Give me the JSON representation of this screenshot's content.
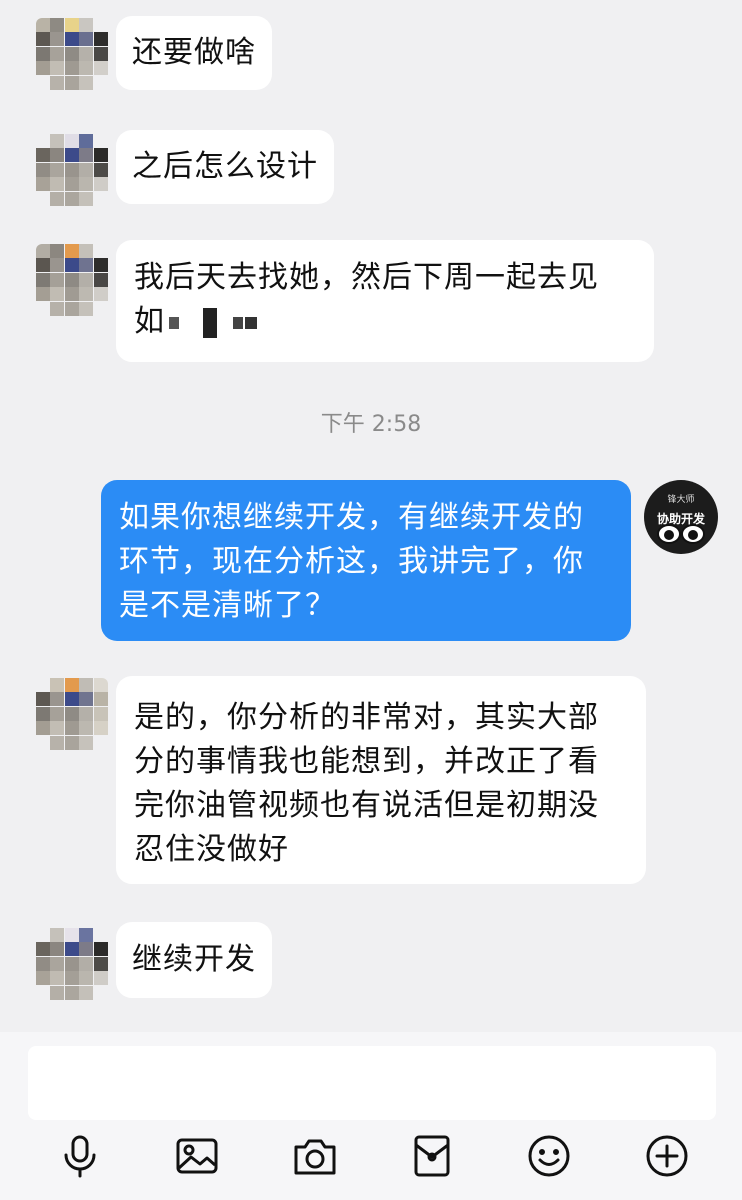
{
  "messages": [
    {
      "dir": "in",
      "text": "还要做啥"
    },
    {
      "dir": "in",
      "text": "之后怎么设计"
    },
    {
      "dir": "in",
      "text_line1": "我后天去找她，然后下周一起去见",
      "text_line2": "如"
    },
    {
      "dir": "out",
      "text_line1": "如果你想继续开发，有继续开发的",
      "text_line2": "环节，现在分析这，我讲完了，你",
      "text_line3": "是不是清晰了？"
    },
    {
      "dir": "in",
      "text_line1": "是的，你分析的非常对，其实大部",
      "text_line2": "分的事情我也能想到，并改正了看",
      "text_line3": "完你油管视频也有说活但是初期没",
      "text_line4": "忍住没做好"
    },
    {
      "dir": "in",
      "text": "继续开发"
    }
  ],
  "timestamp": "下午 2:58",
  "my_avatar": {
    "line1": "锋大师",
    "line2": "协助开发"
  },
  "input": {
    "placeholder": ""
  },
  "toolbar": [
    "mic-icon",
    "image-icon",
    "camera-icon",
    "red-packet-icon",
    "emoji-icon",
    "plus-icon"
  ],
  "colors": {
    "outgoing_bubble": "#2b8cf5",
    "incoming_bubble": "#ffffff",
    "background": "#f0f0f2"
  }
}
